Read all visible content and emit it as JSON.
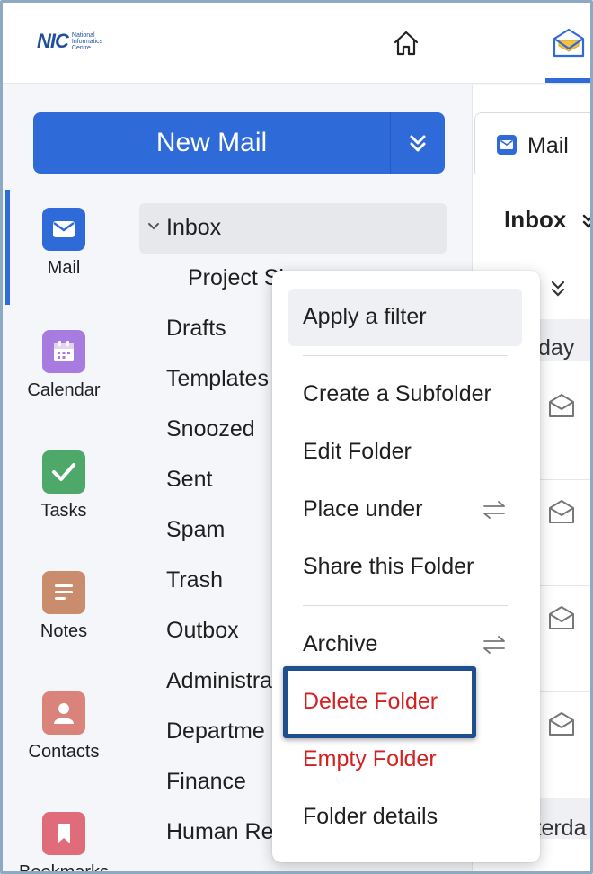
{
  "header": {
    "logo_mark": "NIC",
    "logo_subtitle": "National Informatics Centre",
    "home_icon": "home-icon",
    "mail_app_icon": "mail-app-icon"
  },
  "apps": {
    "items": [
      {
        "label": "Mail",
        "icon": "mail-icon",
        "color": "#2f6ad9"
      },
      {
        "label": "Calendar",
        "icon": "calendar-icon",
        "color": "#a87be0"
      },
      {
        "label": "Tasks",
        "icon": "tasks-icon",
        "color": "#4ea86a"
      },
      {
        "label": "Notes",
        "icon": "notes-icon",
        "color": "#c98c6c"
      },
      {
        "label": "Contacts",
        "icon": "contacts-icon",
        "color": "#d9837a"
      },
      {
        "label": "Bookmarks",
        "icon": "bookmark-icon",
        "color": "#e06b7a"
      }
    ]
  },
  "compose": {
    "label": "New Mail",
    "dropdown_icon": "double-chevron-down-icon"
  },
  "folders": {
    "inbox": "Inbox",
    "items": [
      "Project Sh",
      "Drafts",
      "Templates",
      "Snoozed",
      "Sent",
      "Spam",
      "Trash",
      "Outbox",
      "Administra",
      "Departme",
      "Finance",
      "Human Re"
    ]
  },
  "right_panel": {
    "tab_label": "Mail",
    "folder_title": "Inbox",
    "section_today": "day",
    "section_yesterday": "sterda"
  },
  "context_menu": {
    "items": [
      {
        "label": "Apply a filter",
        "highlighted": true
      },
      {
        "label": "Create a Subfolder"
      },
      {
        "label": "Edit Folder"
      },
      {
        "label": "Place under",
        "icon": "swap-arrows-icon"
      },
      {
        "label": "Share this Folder"
      },
      {
        "label": "Archive",
        "icon": "swap-arrows-icon"
      },
      {
        "label": "Delete Folder",
        "color": "#d42020",
        "callout": true
      },
      {
        "label": "Empty Folder",
        "color": "#d42020"
      },
      {
        "label": "Folder details"
      }
    ]
  },
  "colors": {
    "accent": "#2f6ad9",
    "danger": "#d42020",
    "callout_border": "#1f4f8f"
  }
}
